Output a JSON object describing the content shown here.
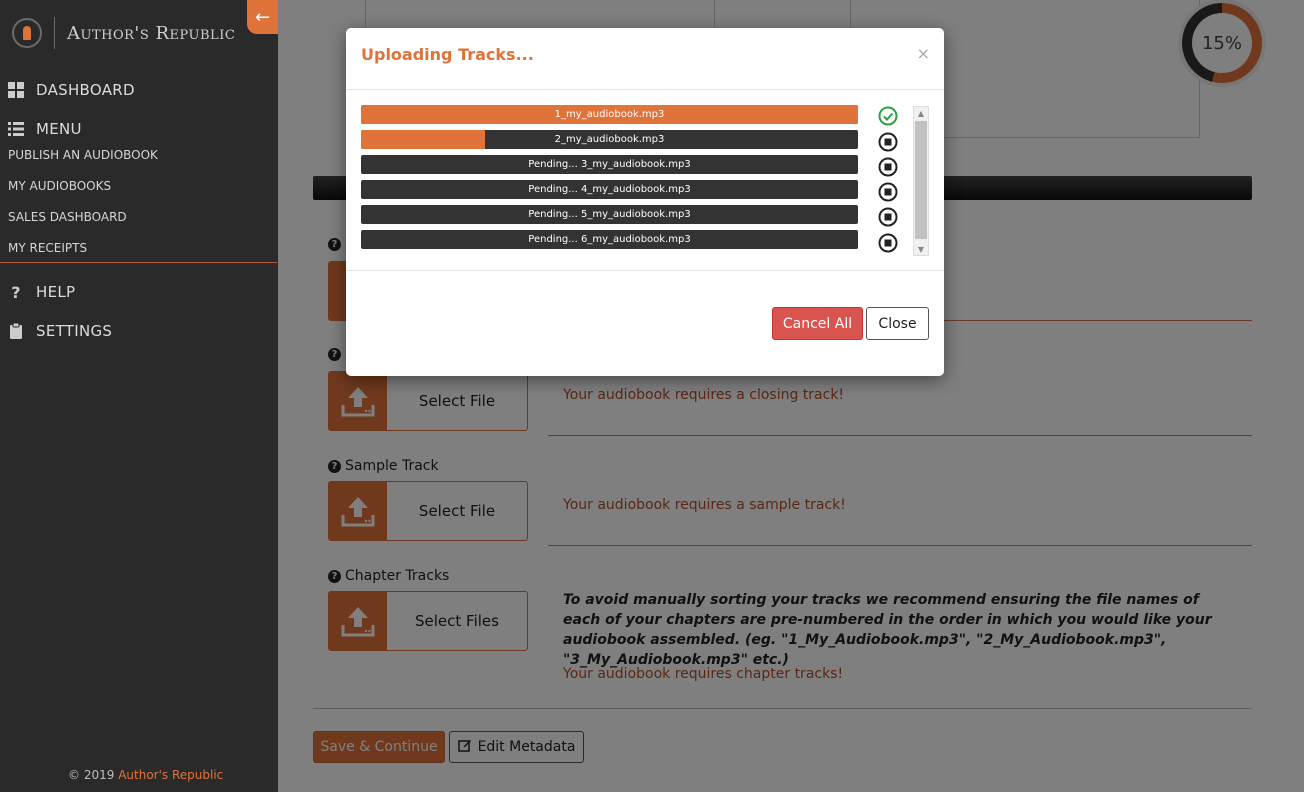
{
  "brand": {
    "name": "Author's Republic"
  },
  "sidebar": {
    "collapse_icon": "arrow-left-icon",
    "dashboard": "DASHBOARD",
    "menu": "MENU",
    "sub_items": [
      {
        "label": "PUBLISH AN AUDIOBOOK"
      },
      {
        "label": "MY AUDIOBOOKS"
      },
      {
        "label": "SALES DASHBOARD"
      },
      {
        "label": "MY RECEIPTS"
      }
    ],
    "help": "HELP",
    "settings": "SETTINGS",
    "footer_prefix": "© 2019",
    "footer_brand": "Author's Republic"
  },
  "progress": {
    "label": "15%",
    "value": 0.15
  },
  "tracks": {
    "closing": {
      "select": "Select File",
      "warning": "Your audiobook requires a closing track!"
    },
    "sample": {
      "label": "Sample Track",
      "select": "Select File",
      "warning": "Your audiobook requires a sample track!"
    },
    "chapter": {
      "label": "Chapter Tracks",
      "select": "Select Files",
      "note": "To avoid manually sorting your tracks we recommend ensuring the file names of each of your chapters are pre-numbered in the order in which you would like your audiobook assembled. (eg. \"1_My_Audiobook.mp3\", \"2_My_Audiobook.mp3\", \"3_My_Audiobook.mp3\" etc.)",
      "warning": "Your audiobook requires chapter tracks!"
    }
  },
  "actions": {
    "save": "Save & Continue",
    "edit_metadata": "Edit Metadata"
  },
  "modal": {
    "title": "Uploading Tracks...",
    "close_symbol": "×",
    "uploads": [
      {
        "label": "1_my_audiobook.mp3",
        "progress": 1.0,
        "status": "done"
      },
      {
        "label": "2_my_audiobook.mp3",
        "progress": 0.25,
        "status": "uploading"
      },
      {
        "label": "Pending... 3_my_audiobook.mp3",
        "progress": 0,
        "status": "pending"
      },
      {
        "label": "Pending... 4_my_audiobook.mp3",
        "progress": 0,
        "status": "pending"
      },
      {
        "label": "Pending... 5_my_audiobook.mp3",
        "progress": 0,
        "status": "pending"
      },
      {
        "label": "Pending... 6_my_audiobook.mp3",
        "progress": 0,
        "status": "pending"
      }
    ],
    "cancel_all": "Cancel All",
    "close": "Close"
  },
  "colors": {
    "accent": "#e0733a",
    "danger": "#d9534f",
    "success": "#2ea043",
    "sidebar": "#2a2a2a"
  }
}
